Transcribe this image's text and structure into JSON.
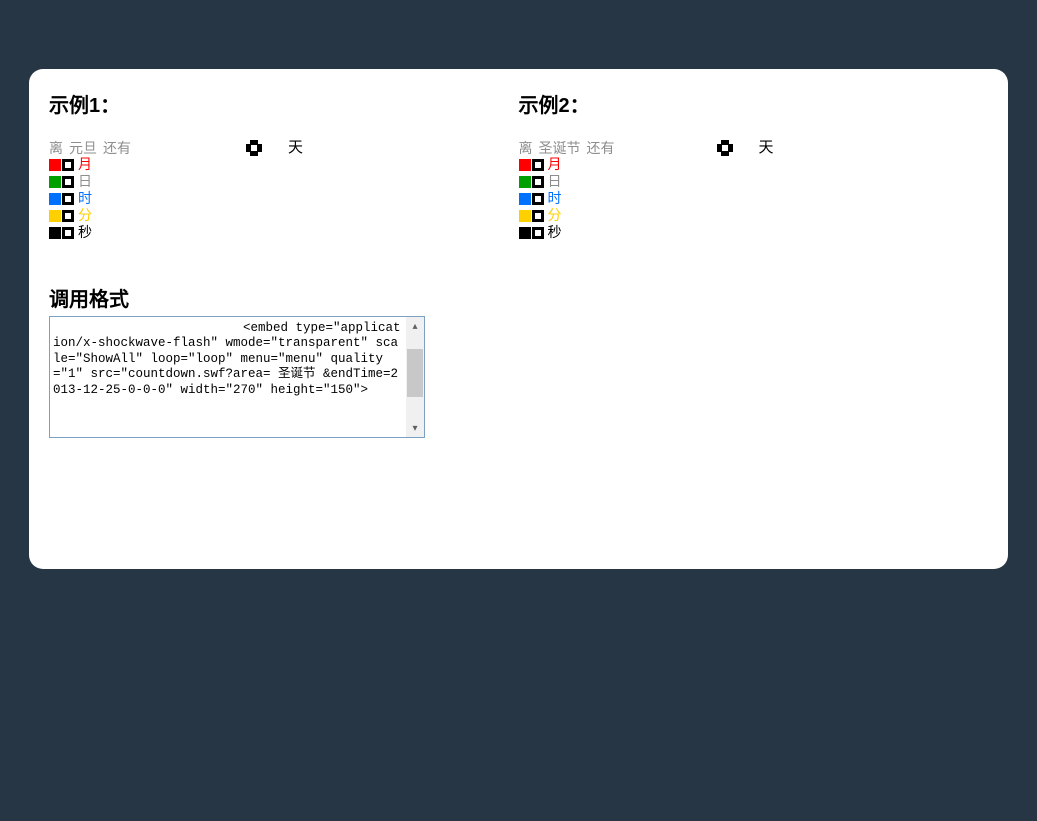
{
  "example1": {
    "heading": "示例1：",
    "prefix": "离",
    "event": "元旦",
    "suffix": "还有",
    "days_label": "天",
    "rows": [
      {
        "color": "red",
        "unit_text": "月",
        "unit_class": "red"
      },
      {
        "color": "green",
        "unit_text": "日",
        "unit_class": "gray"
      },
      {
        "color": "blue",
        "unit_text": "时",
        "unit_class": "blue"
      },
      {
        "color": "yellow",
        "unit_text": "分",
        "unit_class": "yellow"
      },
      {
        "color": "black",
        "unit_text": "秒",
        "unit_class": "black"
      }
    ]
  },
  "example2": {
    "heading": "示例2：",
    "prefix": "离",
    "event": "圣诞节",
    "suffix": "还有",
    "days_label": "天",
    "rows": [
      {
        "color": "red",
        "unit_text": "月",
        "unit_class": "red"
      },
      {
        "color": "green",
        "unit_text": "日",
        "unit_class": "gray"
      },
      {
        "color": "blue",
        "unit_text": "时",
        "unit_class": "blue"
      },
      {
        "color": "yellow",
        "unit_text": "分",
        "unit_class": "yellow"
      },
      {
        "color": "black",
        "unit_text": "秒",
        "unit_class": "black"
      }
    ]
  },
  "call_format": {
    "heading": "调用格式",
    "code": "<embed type=\"application/x-shockwave-flash\" wmode=\"transparent\" scale=\"ShowAll\" loop=\"loop\" menu=\"menu\" quality=\"1\" src=\"countdown.swf?area= 圣诞节 &endTime=2013-12-25-0-0-0\" width=\"270\" height=\"150\">"
  }
}
